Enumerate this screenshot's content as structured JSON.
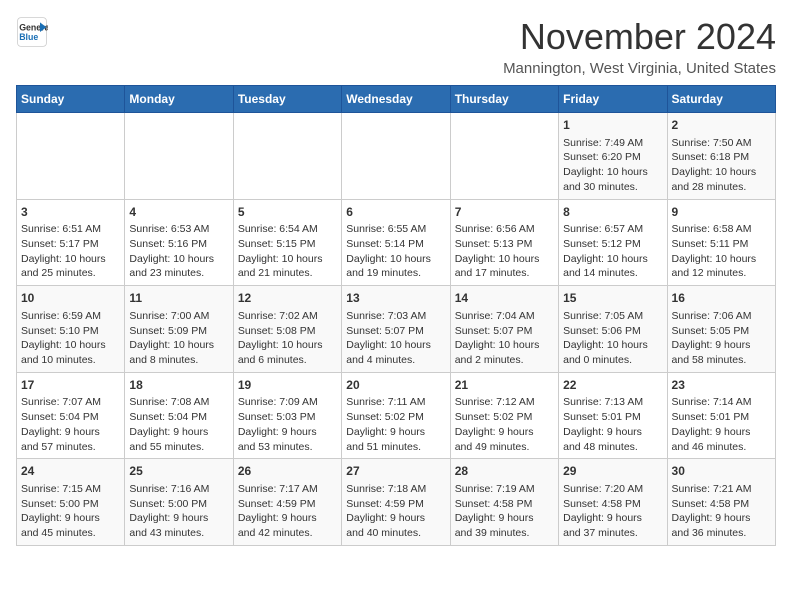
{
  "header": {
    "logo_line1": "General",
    "logo_line2": "Blue",
    "month": "November 2024",
    "location": "Mannington, West Virginia, United States"
  },
  "weekdays": [
    "Sunday",
    "Monday",
    "Tuesday",
    "Wednesday",
    "Thursday",
    "Friday",
    "Saturday"
  ],
  "weeks": [
    [
      {
        "day": "",
        "info": ""
      },
      {
        "day": "",
        "info": ""
      },
      {
        "day": "",
        "info": ""
      },
      {
        "day": "",
        "info": ""
      },
      {
        "day": "",
        "info": ""
      },
      {
        "day": "1",
        "info": "Sunrise: 7:49 AM\nSunset: 6:20 PM\nDaylight: 10 hours\nand 30 minutes."
      },
      {
        "day": "2",
        "info": "Sunrise: 7:50 AM\nSunset: 6:18 PM\nDaylight: 10 hours\nand 28 minutes."
      }
    ],
    [
      {
        "day": "3",
        "info": "Sunrise: 6:51 AM\nSunset: 5:17 PM\nDaylight: 10 hours\nand 25 minutes."
      },
      {
        "day": "4",
        "info": "Sunrise: 6:53 AM\nSunset: 5:16 PM\nDaylight: 10 hours\nand 23 minutes."
      },
      {
        "day": "5",
        "info": "Sunrise: 6:54 AM\nSunset: 5:15 PM\nDaylight: 10 hours\nand 21 minutes."
      },
      {
        "day": "6",
        "info": "Sunrise: 6:55 AM\nSunset: 5:14 PM\nDaylight: 10 hours\nand 19 minutes."
      },
      {
        "day": "7",
        "info": "Sunrise: 6:56 AM\nSunset: 5:13 PM\nDaylight: 10 hours\nand 17 minutes."
      },
      {
        "day": "8",
        "info": "Sunrise: 6:57 AM\nSunset: 5:12 PM\nDaylight: 10 hours\nand 14 minutes."
      },
      {
        "day": "9",
        "info": "Sunrise: 6:58 AM\nSunset: 5:11 PM\nDaylight: 10 hours\nand 12 minutes."
      }
    ],
    [
      {
        "day": "10",
        "info": "Sunrise: 6:59 AM\nSunset: 5:10 PM\nDaylight: 10 hours\nand 10 minutes."
      },
      {
        "day": "11",
        "info": "Sunrise: 7:00 AM\nSunset: 5:09 PM\nDaylight: 10 hours\nand 8 minutes."
      },
      {
        "day": "12",
        "info": "Sunrise: 7:02 AM\nSunset: 5:08 PM\nDaylight: 10 hours\nand 6 minutes."
      },
      {
        "day": "13",
        "info": "Sunrise: 7:03 AM\nSunset: 5:07 PM\nDaylight: 10 hours\nand 4 minutes."
      },
      {
        "day": "14",
        "info": "Sunrise: 7:04 AM\nSunset: 5:07 PM\nDaylight: 10 hours\nand 2 minutes."
      },
      {
        "day": "15",
        "info": "Sunrise: 7:05 AM\nSunset: 5:06 PM\nDaylight: 10 hours\nand 0 minutes."
      },
      {
        "day": "16",
        "info": "Sunrise: 7:06 AM\nSunset: 5:05 PM\nDaylight: 9 hours\nand 58 minutes."
      }
    ],
    [
      {
        "day": "17",
        "info": "Sunrise: 7:07 AM\nSunset: 5:04 PM\nDaylight: 9 hours\nand 57 minutes."
      },
      {
        "day": "18",
        "info": "Sunrise: 7:08 AM\nSunset: 5:04 PM\nDaylight: 9 hours\nand 55 minutes."
      },
      {
        "day": "19",
        "info": "Sunrise: 7:09 AM\nSunset: 5:03 PM\nDaylight: 9 hours\nand 53 minutes."
      },
      {
        "day": "20",
        "info": "Sunrise: 7:11 AM\nSunset: 5:02 PM\nDaylight: 9 hours\nand 51 minutes."
      },
      {
        "day": "21",
        "info": "Sunrise: 7:12 AM\nSunset: 5:02 PM\nDaylight: 9 hours\nand 49 minutes."
      },
      {
        "day": "22",
        "info": "Sunrise: 7:13 AM\nSunset: 5:01 PM\nDaylight: 9 hours\nand 48 minutes."
      },
      {
        "day": "23",
        "info": "Sunrise: 7:14 AM\nSunset: 5:01 PM\nDaylight: 9 hours\nand 46 minutes."
      }
    ],
    [
      {
        "day": "24",
        "info": "Sunrise: 7:15 AM\nSunset: 5:00 PM\nDaylight: 9 hours\nand 45 minutes."
      },
      {
        "day": "25",
        "info": "Sunrise: 7:16 AM\nSunset: 5:00 PM\nDaylight: 9 hours\nand 43 minutes."
      },
      {
        "day": "26",
        "info": "Sunrise: 7:17 AM\nSunset: 4:59 PM\nDaylight: 9 hours\nand 42 minutes."
      },
      {
        "day": "27",
        "info": "Sunrise: 7:18 AM\nSunset: 4:59 PM\nDaylight: 9 hours\nand 40 minutes."
      },
      {
        "day": "28",
        "info": "Sunrise: 7:19 AM\nSunset: 4:58 PM\nDaylight: 9 hours\nand 39 minutes."
      },
      {
        "day": "29",
        "info": "Sunrise: 7:20 AM\nSunset: 4:58 PM\nDaylight: 9 hours\nand 37 minutes."
      },
      {
        "day": "30",
        "info": "Sunrise: 7:21 AM\nSunset: 4:58 PM\nDaylight: 9 hours\nand 36 minutes."
      }
    ]
  ]
}
